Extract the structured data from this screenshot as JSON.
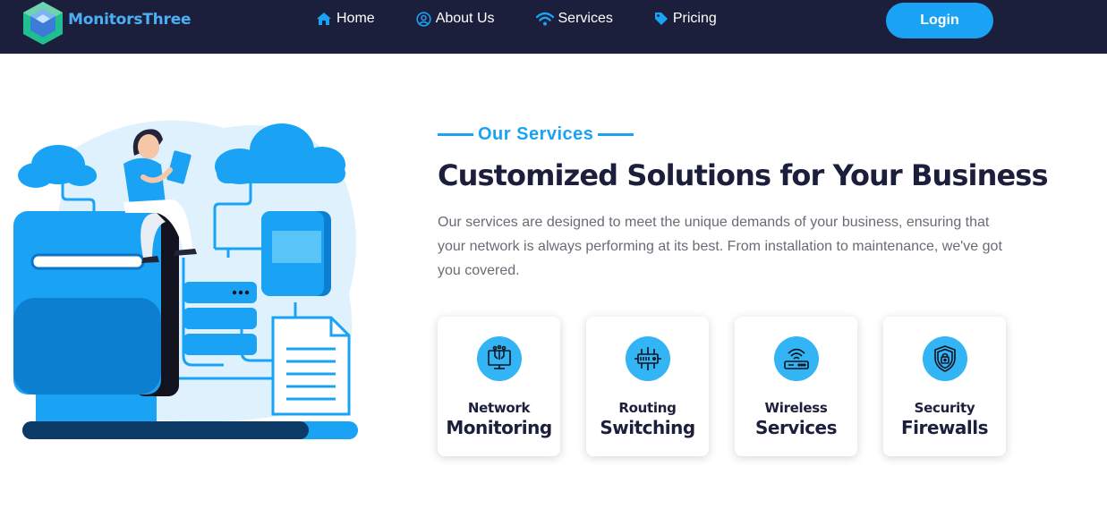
{
  "brand": {
    "name": "MonitorsThree"
  },
  "nav": {
    "items": [
      {
        "label": "Home",
        "icon": "home-icon"
      },
      {
        "label": "About Us",
        "icon": "user-circle-icon"
      },
      {
        "label": "Services",
        "icon": "wifi-icon"
      },
      {
        "label": "Pricing",
        "icon": "tag-icon"
      }
    ],
    "login_label": "Login"
  },
  "services": {
    "eyebrow": "Our Services",
    "heading": "Customized Solutions for Your Business",
    "description": "Our services are designed to meet the unique demands of your business, ensuring that your network is always performing at its best. From installation to maintenance, we've got you covered.",
    "cards": [
      {
        "line1": "Network",
        "line2": "Monitoring",
        "icon": "network-monitor-icon"
      },
      {
        "line1": "Routing",
        "line2": "Switching",
        "icon": "switch-icon"
      },
      {
        "line1": "Wireless",
        "line2": "Services",
        "icon": "router-icon"
      },
      {
        "line1": "Security",
        "line2": "Firewalls",
        "icon": "shield-lock-icon"
      }
    ]
  },
  "colors": {
    "navbar_bg": "#1c1f3b",
    "accent": "#1aa3f4",
    "heading": "#1c1f3b",
    "body_text": "#6b6b75",
    "icon_circle": "#33b4f4"
  }
}
